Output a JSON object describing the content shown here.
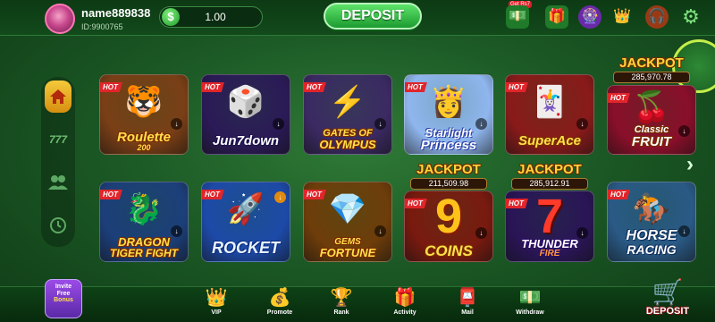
{
  "header": {
    "username": "name889838",
    "user_id": "ID:9900765",
    "balance": "1.00",
    "currency_symbol": "$",
    "deposit_label": "DEPOSIT",
    "gift_tag": "Get Rs7"
  },
  "top_icons": [
    "cash-gift-icon",
    "gift-box-icon",
    "lucky-wheel-icon",
    "events-icon",
    "support-agent-icon",
    "settings-gear-icon"
  ],
  "sidenav": {
    "items": [
      "home-icon",
      "slots-777-icon",
      "players-icon",
      "history-icon"
    ],
    "active_index": 0
  },
  "games": [
    {
      "name": "Roulette",
      "sub": "200",
      "hot": "HOT",
      "art": "🐯",
      "bg": "#7a3f16"
    },
    {
      "name": "Jun7down",
      "sub": "",
      "hot": "HOT",
      "art": "🎲",
      "bg": "#2b1a57"
    },
    {
      "name": "GATES OF",
      "sub": "OLYMPUS",
      "hot": "HOT",
      "art": "⚡",
      "bg": "#3b2a63"
    },
    {
      "name": "Starlight",
      "sub": "Princess",
      "hot": "HOT",
      "art": "👸",
      "bg": "#8fb6ee"
    },
    {
      "name": "SuperAce",
      "sub": "",
      "hot": "HOT",
      "art": "🃏",
      "bg": "#8a1a1a"
    },
    {
      "name": "Classic",
      "sub": "FRUIT",
      "hot": "HOT",
      "art": "🍒",
      "bg": "#8a0f2a",
      "jackpot": "JACKPOT",
      "jackpot_value": "285,970.78"
    },
    {
      "name": "DRAGON",
      "sub": "TIGER FIGHT",
      "hot": "HOT",
      "art": "🐉",
      "bg": "#1c3f7a"
    },
    {
      "name": "ROCKET",
      "sub": "",
      "hot": "HOT",
      "art": "🚀",
      "bg": "#1d4aa8"
    },
    {
      "name": "GEMS",
      "sub": "FORTUNE",
      "hot": "HOT",
      "art": "💎",
      "bg": "#6e3d0a"
    },
    {
      "name": "COINS",
      "sub": "",
      "hot": "HOT",
      "art": "9",
      "bg": "#7a1a0f",
      "jackpot": "JACKPOT",
      "jackpot_value": "211,509.98"
    },
    {
      "name": "THUNDER",
      "sub": "FIRE",
      "hot": "HOT",
      "art": "7",
      "bg": "#2a1557",
      "jackpot": "JACKPOT",
      "jackpot_value": "285,912.91"
    },
    {
      "name": "HORSE",
      "sub": "RACING",
      "hot": "HOT",
      "art": "🏇",
      "bg": "#2a5a86"
    }
  ],
  "invite": {
    "line1": "Invite",
    "line2": "Free",
    "line3": "Bonus"
  },
  "bottom_nav": [
    {
      "label": "VIP",
      "icon": "crown-icon",
      "glyph": "👑"
    },
    {
      "label": "Promote",
      "icon": "coins-stack-icon",
      "glyph": "💰"
    },
    {
      "label": "Rank",
      "icon": "trophy-icon",
      "glyph": "🏆"
    },
    {
      "label": "Activity",
      "icon": "gift-activity-icon",
      "glyph": "🎁"
    },
    {
      "label": "Mail",
      "icon": "mailbox-icon",
      "glyph": "📮"
    },
    {
      "label": "Withdraw",
      "icon": "withdraw-arrow-icon",
      "glyph": "💵"
    }
  ],
  "bottom_deposit": {
    "label": "DEPOSIT",
    "icon": "shopping-cart-icon"
  },
  "colors": {
    "accent_green": "#1c9b30",
    "hot_red": "#e0252b",
    "title_gold": "#ffe04a",
    "nav_active": "#f5c93a"
  }
}
